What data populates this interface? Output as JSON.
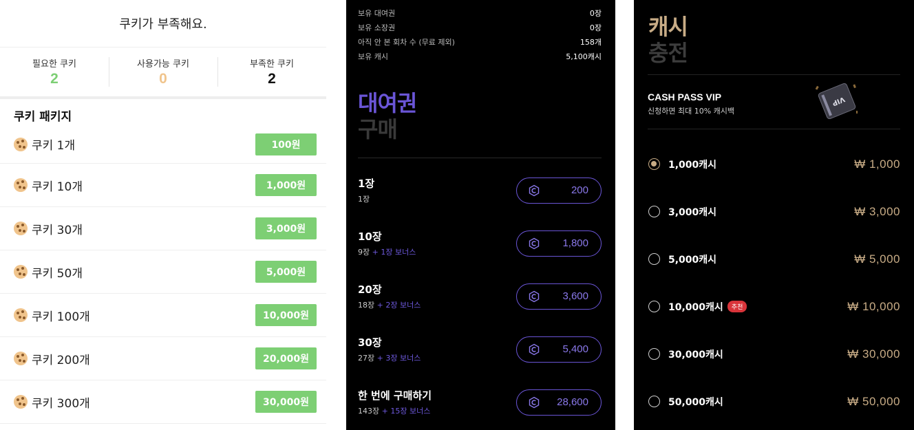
{
  "cookie_panel": {
    "title": "쿠키가 부족해요.",
    "stats": [
      {
        "label": "필요한 쿠키",
        "value": "2",
        "color": "#7dcf74"
      },
      {
        "label": "사용가능 쿠키",
        "value": "0",
        "color": "#f0c48c"
      },
      {
        "label": "부족한 쿠키",
        "value": "2",
        "color": "#111111"
      }
    ],
    "section_title": "쿠키 패키지",
    "packages": [
      {
        "label": "쿠키 1개",
        "price": "100원"
      },
      {
        "label": "쿠키 10개",
        "price": "1,000원"
      },
      {
        "label": "쿠키 30개",
        "price": "3,000원"
      },
      {
        "label": "쿠키 50개",
        "price": "5,000원"
      },
      {
        "label": "쿠키 100개",
        "price": "10,000원"
      },
      {
        "label": "쿠키 200개",
        "price": "20,000원"
      },
      {
        "label": "쿠키 300개",
        "price": "30,000원"
      }
    ]
  },
  "rental_panel": {
    "info": [
      {
        "label": "보유 대여권",
        "value": "0장"
      },
      {
        "label": "보유 소장권",
        "value": "0장"
      },
      {
        "label": "아직 안 본 회차 수 (무료 제외)",
        "value": "158개"
      },
      {
        "label": "보유 캐시",
        "value": "5,100캐시"
      }
    ],
    "heading_primary": "대여권",
    "heading_secondary": "구매",
    "options": [
      {
        "name": "1장",
        "sub": "1장",
        "bonus": "",
        "price": "200"
      },
      {
        "name": "10장",
        "sub": "9장",
        "bonus": "+ 1장 보너스",
        "price": "1,800"
      },
      {
        "name": "20장",
        "sub": "18장",
        "bonus": "+ 2장 보너스",
        "price": "3,600"
      },
      {
        "name": "30장",
        "sub": "27장",
        "bonus": "+ 3장 보너스",
        "price": "5,400"
      },
      {
        "name": "한 번에 구매하기",
        "sub": "143장",
        "bonus": "+ 15장 보너스",
        "price": "28,600"
      }
    ]
  },
  "cash_panel": {
    "heading_primary": "캐시",
    "heading_secondary": "충전",
    "banner": {
      "title": "CASH PASS VIP",
      "subtitle": "신청하면 최대 10% 캐시백",
      "card_text": "VIP"
    },
    "options": [
      {
        "label": "1,000캐시",
        "price": "₩ 1,000",
        "selected": true,
        "badge": ""
      },
      {
        "label": "3,000캐시",
        "price": "₩ 3,000",
        "selected": false,
        "badge": ""
      },
      {
        "label": "5,000캐시",
        "price": "₩ 5,000",
        "selected": false,
        "badge": ""
      },
      {
        "label": "10,000캐시",
        "price": "₩ 10,000",
        "selected": false,
        "badge": "추천"
      },
      {
        "label": "30,000캐시",
        "price": "₩ 30,000",
        "selected": false,
        "badge": ""
      },
      {
        "label": "50,000캐시",
        "price": "₩ 50,000",
        "selected": false,
        "badge": ""
      }
    ]
  },
  "colors": {
    "cookie_green": "#7dcf74",
    "rental_purple": "#6a55d6",
    "cash_gold": "#c8ac86",
    "badge_red": "#d9343a"
  }
}
